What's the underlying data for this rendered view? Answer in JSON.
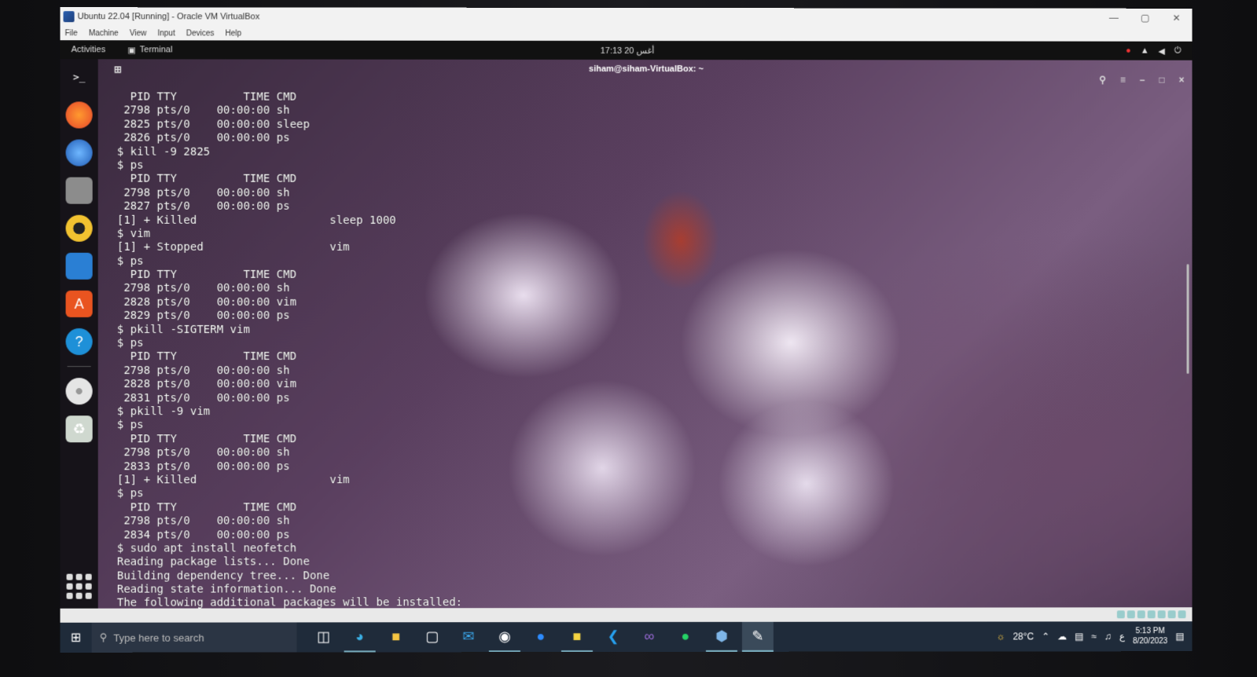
{
  "vbox": {
    "window_title": "Ubuntu 22.04 [Running] - Oracle VM VirtualBox",
    "menu": [
      "File",
      "Machine",
      "View",
      "Input",
      "Devices",
      "Help"
    ]
  },
  "ubuntu": {
    "activities_label": "Activities",
    "app_label": "Terminal",
    "clock": "17:13 20 أغس"
  },
  "terminal": {
    "title": "siham@siham-VirtualBox: ~",
    "lines": [
      "  PID TTY          TIME CMD",
      " 2798 pts/0    00:00:00 sh",
      " 2825 pts/0    00:00:00 sleep",
      " 2826 pts/0    00:00:00 ps",
      "$ kill -9 2825",
      "$ ps",
      "  PID TTY          TIME CMD",
      " 2798 pts/0    00:00:00 sh",
      " 2827 pts/0    00:00:00 ps",
      "[1] + Killed                    sleep 1000",
      "$ vim",
      "[1] + Stopped                   vim",
      "$ ps",
      "  PID TTY          TIME CMD",
      " 2798 pts/0    00:00:00 sh",
      " 2828 pts/0    00:00:00 vim",
      " 2829 pts/0    00:00:00 ps",
      "$ pkill -SIGTERM vim",
      "$ ps",
      "  PID TTY          TIME CMD",
      " 2798 pts/0    00:00:00 sh",
      " 2828 pts/0    00:00:00 vim",
      " 2831 pts/0    00:00:00 ps",
      "$ pkill -9 vim",
      "$ ps",
      "  PID TTY          TIME CMD",
      " 2798 pts/0    00:00:00 sh",
      " 2833 pts/0    00:00:00 ps",
      "[1] + Killed                    vim",
      "$ ps",
      "  PID TTY          TIME CMD",
      " 2798 pts/0    00:00:00 sh",
      " 2834 pts/0    00:00:00 ps",
      "$ sudo apt install neofetch",
      "Reading package lists... Done",
      "Building dependency tree... Done",
      "Reading state information... Done",
      "The following additional packages will be installed:"
    ]
  },
  "taskbar": {
    "search_placeholder": "Type here to search",
    "weather": "28°C",
    "time": "5:13 PM",
    "date": "8/20/2023",
    "lang": "ع"
  },
  "colors": {
    "taskbar_bg": "#1f2b3a",
    "ubuntu_topbar": "#111111",
    "vbox_chrome": "#f2f2f2"
  }
}
